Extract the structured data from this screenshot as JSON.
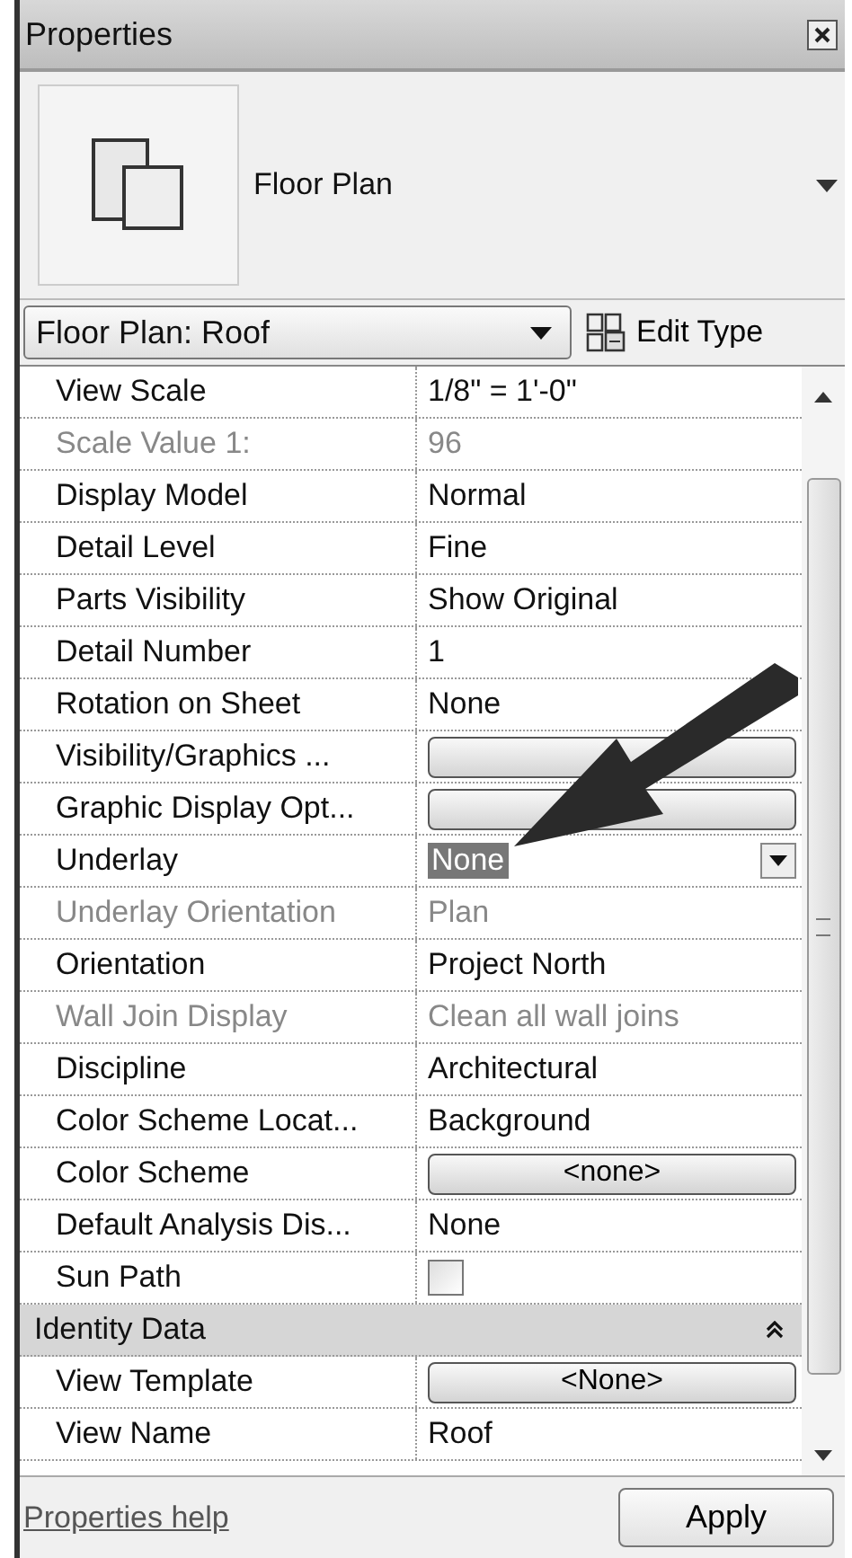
{
  "window": {
    "title": "Properties"
  },
  "type_preview": {
    "name": "Floor Plan"
  },
  "type_selector": {
    "value": "Floor Plan: Roof"
  },
  "edit_type_button": {
    "label": "Edit Type"
  },
  "properties": [
    {
      "kind": "text",
      "label": "View Scale",
      "value": "1/8\" = 1'-0\"",
      "disabled": false
    },
    {
      "kind": "text",
      "label": "Scale Value    1:",
      "value": "96",
      "disabled": true
    },
    {
      "kind": "text",
      "label": "Display Model",
      "value": "Normal",
      "disabled": false
    },
    {
      "kind": "text",
      "label": "Detail Level",
      "value": "Fine",
      "disabled": false
    },
    {
      "kind": "text",
      "label": "Parts Visibility",
      "value": "Show Original",
      "disabled": false
    },
    {
      "kind": "text",
      "label": "Detail Number",
      "value": "1",
      "disabled": false
    },
    {
      "kind": "text",
      "label": "Rotation on Sheet",
      "value": "None",
      "disabled": false
    },
    {
      "kind": "button",
      "label": "Visibility/Graphics ...",
      "disabled": false
    },
    {
      "kind": "button",
      "label": "Graphic Display Opt...",
      "disabled": false
    },
    {
      "kind": "dropdown",
      "label": "Underlay",
      "value": "None",
      "highlighted": true,
      "disabled": false
    },
    {
      "kind": "text",
      "label": "Underlay Orientation",
      "value": "Plan",
      "disabled": true
    },
    {
      "kind": "text",
      "label": "Orientation",
      "value": "Project North",
      "disabled": false
    },
    {
      "kind": "text",
      "label": "Wall Join Display",
      "value": "Clean all wall joins",
      "disabled": true
    },
    {
      "kind": "text",
      "label": "Discipline",
      "value": "Architectural",
      "disabled": false
    },
    {
      "kind": "text",
      "label": "Color Scheme Locat...",
      "value": "Background",
      "disabled": false
    },
    {
      "kind": "button",
      "label": "Color Scheme",
      "value": "<none>",
      "disabled": false
    },
    {
      "kind": "text",
      "label": "Default Analysis Dis...",
      "value": "None",
      "disabled": false
    },
    {
      "kind": "checkbox",
      "label": "Sun Path",
      "checked": false,
      "disabled": false
    },
    {
      "kind": "group",
      "label": "Identity Data",
      "expanded": true
    },
    {
      "kind": "button",
      "label": "View Template",
      "value": "<None>",
      "disabled": false
    },
    {
      "kind": "text",
      "label": "View Name",
      "value": "Roof",
      "disabled": false
    }
  ],
  "help_link": "Properties help",
  "apply_button": "Apply"
}
